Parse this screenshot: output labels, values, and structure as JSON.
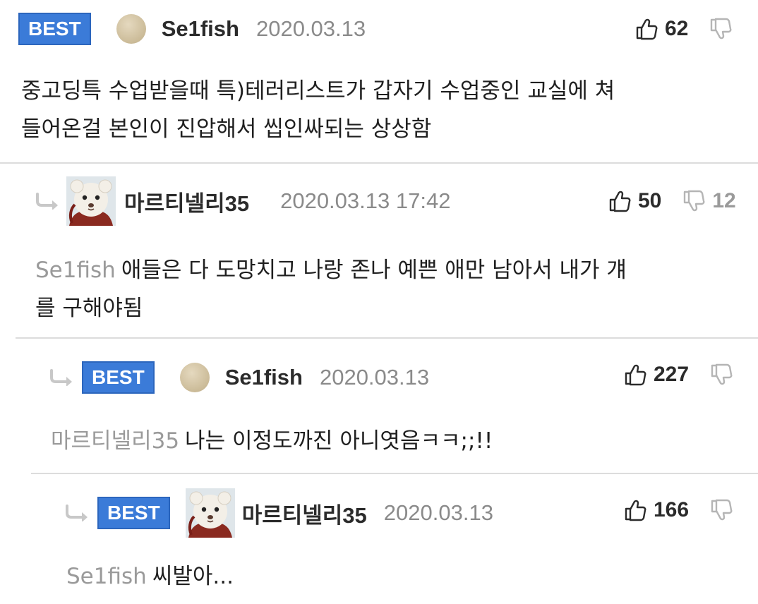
{
  "icons": {
    "reply": "reply-arrow-icon",
    "like": "thumbs-up-icon",
    "dislike": "thumbs-down-icon",
    "avatar_plain": "beige-circle-avatar",
    "avatar_image": "bear-doll-avatar"
  },
  "colors": {
    "best_badge": "#3b7bd8",
    "mention": "#9a9a9a",
    "date": "#8a8a8a",
    "divider": "#dcdcdc"
  },
  "comments": [
    {
      "badge": "BEST",
      "nickname": "Se1fish",
      "date": "2020.03.13",
      "likes": "62",
      "dislikes": "",
      "mention": "",
      "lines": [
        "중고딩특 수업받을때 특)테러리스트가 갑자기 수업중인 교실에 쳐",
        "들어온걸 본인이 진압해서 씹인싸되는 상상함"
      ]
    },
    {
      "badge": "",
      "nickname": "마르티넬리35",
      "date": "2020.03.13 17:42",
      "likes": "50",
      "dislikes": "12",
      "mention": "Se1fish",
      "lines": [
        "애들은 다 도망치고 나랑 존나 예쁜 애만 남아서 내가 걔",
        "를 구해야됨"
      ]
    },
    {
      "badge": "BEST",
      "nickname": "Se1fish",
      "date": "2020.03.13",
      "likes": "227",
      "dislikes": "",
      "mention": "마르티넬리35",
      "lines": [
        "나는 이정도까진 아니엿음ㅋㅋ;;!!"
      ]
    },
    {
      "badge": "BEST",
      "nickname": "마르티넬리35",
      "date": "2020.03.13",
      "likes": "166",
      "dislikes": "",
      "mention": "Se1fish",
      "lines": [
        "씨발아..."
      ]
    }
  ]
}
